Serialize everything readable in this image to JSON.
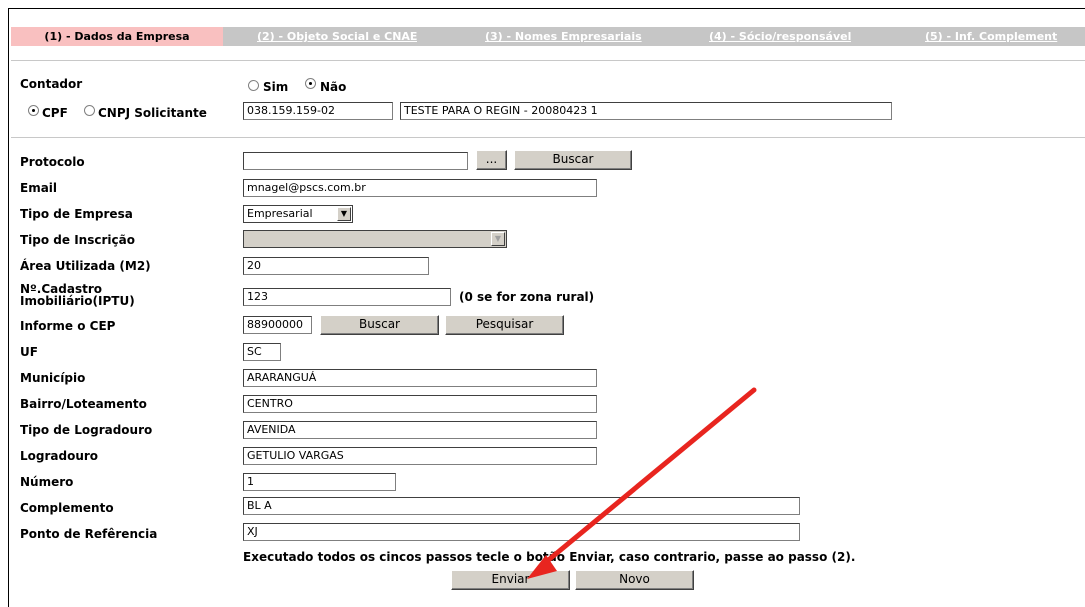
{
  "tabs": [
    {
      "label": "(1) - Dados da Empresa",
      "active": true
    },
    {
      "label": "(2) - Objeto Social e CNAE"
    },
    {
      "label": "(3) - Nomes Empresariais"
    },
    {
      "label": "(4) - Sócio/responsável"
    },
    {
      "label": "(5) - Inf. Complement"
    }
  ],
  "contador": {
    "label": "Contador",
    "sim": "Sim",
    "nao": "Não",
    "selected": "Não"
  },
  "solicitante": {
    "cpf_label": "CPF",
    "cnpj_label": "CNPJ Solicitante",
    "selected": "CPF",
    "document_value": "038.159.159-02",
    "name_value": "TESTE PARA O REGIN - 20080423 1"
  },
  "form": {
    "protocolo": {
      "label": "Protocolo",
      "value": "",
      "browse_label": "...",
      "search_label": "Buscar"
    },
    "email": {
      "label": "Email",
      "value": "mnagel@pscs.com.br"
    },
    "tipo_empresa": {
      "label": "Tipo de Empresa",
      "value": "Empresarial"
    },
    "tipo_inscricao": {
      "label": "Tipo de Inscrição",
      "value": ""
    },
    "area": {
      "label": "Área Utilizada (M2)",
      "value": "20"
    },
    "cadastro": {
      "label_line1": "Nº.Cadastro",
      "label_line2": "Imobiliário(IPTU)",
      "value": "123",
      "hint": "(0 se for zona rural)"
    },
    "cep": {
      "label": "Informe o CEP",
      "value": "88900000",
      "search_label": "Buscar",
      "lookup_label": "Pesquisar"
    },
    "uf": {
      "label": "UF",
      "value": "SC"
    },
    "municipio": {
      "label": "Município",
      "value": "ARARANGUÁ"
    },
    "bairro": {
      "label": "Bairro/Loteamento",
      "value": "CENTRO"
    },
    "tipo_logradouro": {
      "label": "Tipo de Logradouro",
      "value": "AVENIDA"
    },
    "logradouro": {
      "label": "Logradouro",
      "value": "GETULIO VARGAS"
    },
    "numero": {
      "label": "Número",
      "value": "1"
    },
    "complemento": {
      "label": "Complemento",
      "value": "BL A"
    },
    "referencia": {
      "label": "Ponto de Refêrencia",
      "value": "XJ"
    }
  },
  "instruction": "Executado todos os cincos passos tecle o botão Enviar, caso contrario, passe ao passo (2).",
  "actions": {
    "submit_label": "Enviar",
    "new_label": "Novo"
  },
  "annotation": {
    "arrow_color": "#e8251f"
  },
  "colors": {
    "active_tab": "#f9c0c0",
    "tab_bar": "#c6c6c6",
    "button_face": "#d4d0c8"
  }
}
